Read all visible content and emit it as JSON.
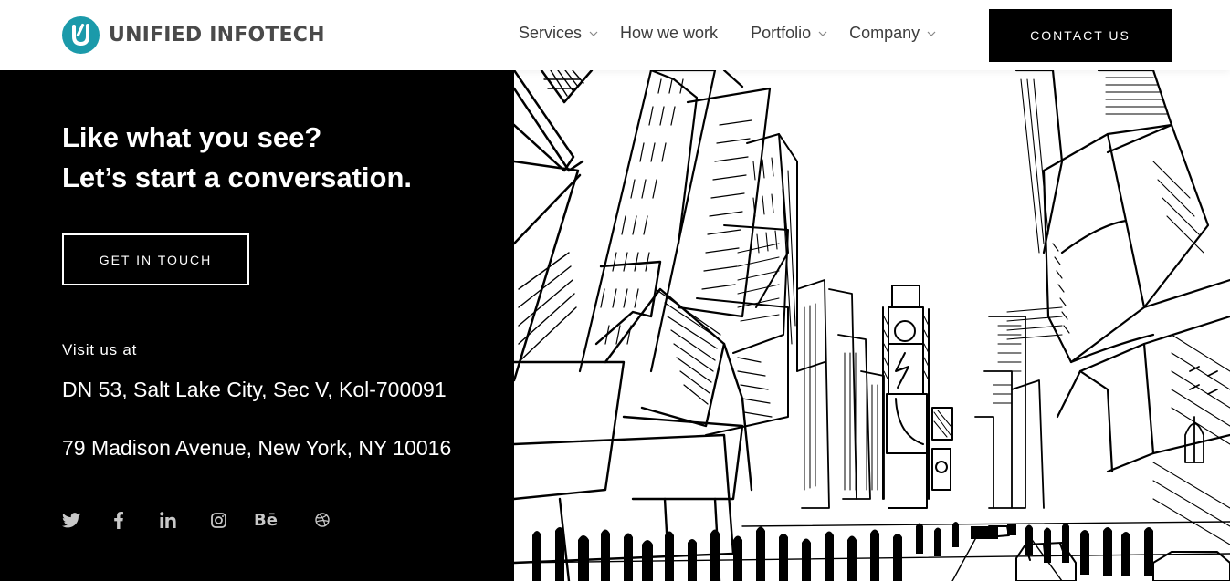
{
  "header": {
    "logo_text": "UNIFIED INFOTECH",
    "brand_color": "#1b9aaa",
    "nav": [
      {
        "label": "Services",
        "has_dropdown": true
      },
      {
        "label": "How we work",
        "has_dropdown": false
      },
      {
        "label": "Portfolio",
        "has_dropdown": true
      },
      {
        "label": "Company",
        "has_dropdown": true
      }
    ],
    "contact_button": "CONTACT US"
  },
  "hero": {
    "headline_line1": "Like what you see?",
    "headline_line2": "Let’s start a conversation.",
    "cta_button": "GET IN TOUCH",
    "visit_label": "Visit us at",
    "addresses": [
      "DN 53, Salt Lake City, Sec V, Kol-700091",
      "79 Madison Avenue, New York, NY 10016"
    ],
    "socials": [
      {
        "name": "twitter",
        "icon": "twitter-icon"
      },
      {
        "name": "facebook",
        "icon": "facebook-icon",
        "glyph": "f"
      },
      {
        "name": "linkedin",
        "icon": "linkedin-icon",
        "glyph": "in"
      },
      {
        "name": "instagram",
        "icon": "instagram-icon"
      },
      {
        "name": "behance",
        "icon": "behance-icon",
        "glyph": "Bē"
      },
      {
        "name": "dribbble",
        "icon": "dribbble-icon"
      }
    ]
  },
  "illustration": {
    "description": "Black and white sketch of Times Square, New York"
  }
}
